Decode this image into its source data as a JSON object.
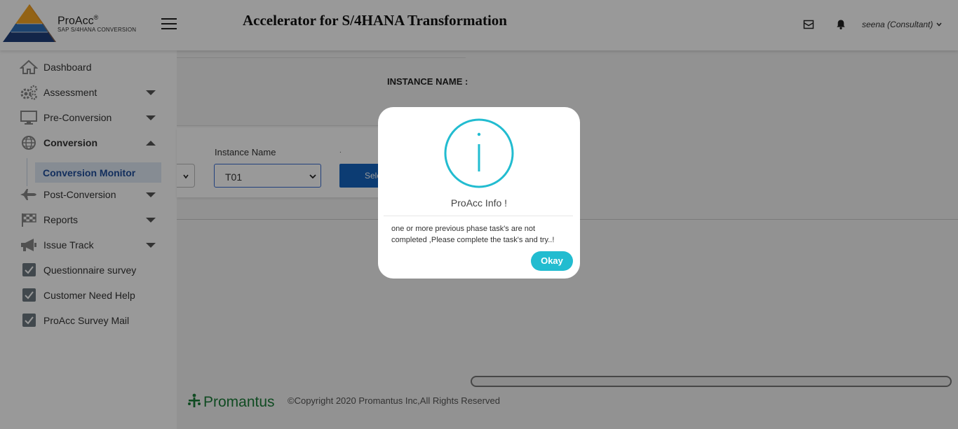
{
  "header": {
    "brand_name": "ProAcc",
    "brand_mark": "®",
    "brand_subtitle": "SAP S/4HANA CONVERSION",
    "app_title": "Accelerator for S/4HANA Transformation",
    "user_name": "seena (Consultant)",
    "icons": [
      "hamburger-menu-icon",
      "mail-icon",
      "bell-icon",
      "chevron-down-icon"
    ]
  },
  "sidebar": {
    "items": [
      {
        "label": "Dashboard",
        "icon": "home-icon"
      },
      {
        "label": "Assessment",
        "icon": "gears-icon"
      },
      {
        "label": "Pre-Conversion",
        "icon": "monitor-icon"
      },
      {
        "label": "Conversion",
        "icon": "globe-icon"
      },
      {
        "label": "Post-Conversion",
        "icon": "airplane-icon"
      },
      {
        "label": "Reports",
        "icon": "checkered-flag-icon"
      },
      {
        "label": "Issue Track",
        "icon": "megaphone-icon"
      },
      {
        "label": "Questionnaire survey",
        "icon": "checkbox-icon"
      },
      {
        "label": "Customer Need Help",
        "icon": "checkbox-icon"
      },
      {
        "label": "ProAcc Survey Mail",
        "icon": "checkbox-icon"
      }
    ],
    "active_submenu": "Conversion Monitor"
  },
  "main": {
    "instance_heading": "INSTANCE NAME :",
    "instance_label": "Instance Name",
    "dot_label": ".",
    "instance_value": "T01",
    "select_button": "Sele"
  },
  "footer": {
    "brand": "Promantus",
    "copyright": "©Copyright 2020 Promantus Inc,All Rights Reserved"
  },
  "modal": {
    "icon": "info-icon",
    "title": "ProAcc Info !",
    "message": "one or more previous phase task's are not completed ,Please complete the task's and try..!",
    "button": "Okay"
  },
  "colors": {
    "accent_teal": "#22bcd0",
    "primary_blue": "#1565c0",
    "submenu_bg": "#dfe9f6",
    "submenu_text": "#1f4e9b",
    "footer_green": "#1b7d3a"
  }
}
